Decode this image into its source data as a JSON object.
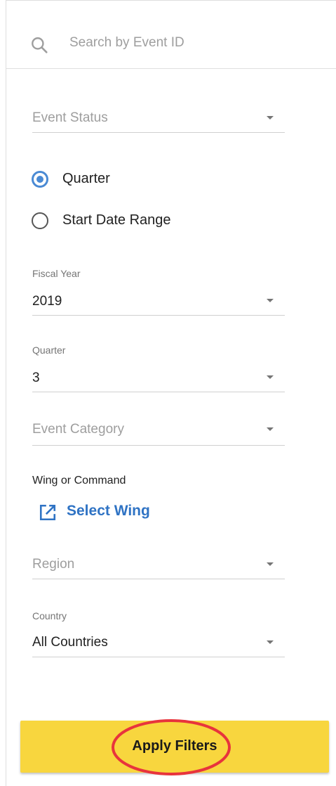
{
  "search": {
    "placeholder": "Search by Event ID",
    "value": "",
    "icon": "search-icon"
  },
  "event_status": {
    "placeholder": "Event Status",
    "value": ""
  },
  "date_mode": {
    "options": [
      {
        "label": "Quarter",
        "selected": true
      },
      {
        "label": "Start Date Range",
        "selected": false
      }
    ]
  },
  "fiscal_year": {
    "label": "Fiscal Year",
    "value": "2019"
  },
  "quarter": {
    "label": "Quarter",
    "value": "3"
  },
  "event_category": {
    "placeholder": "Event Category",
    "value": ""
  },
  "wing_or_command": {
    "label": "Wing or Command",
    "link_label": "Select Wing",
    "icon": "external-link-icon"
  },
  "region": {
    "placeholder": "Region",
    "value": ""
  },
  "country": {
    "label": "Country",
    "value": "All Countries"
  },
  "apply": {
    "label": "Apply Filters"
  },
  "colors": {
    "accent_blue": "#4a8ad4",
    "link_blue": "#2f73c4",
    "button_yellow": "#f8d63e",
    "annotation_red": "#e8343c",
    "placeholder_gray": "#9e9e9e"
  }
}
